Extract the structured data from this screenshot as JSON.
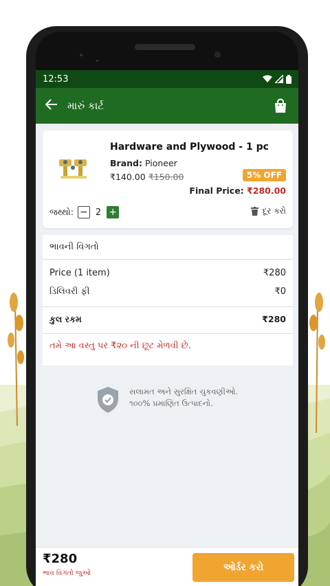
{
  "status": {
    "time": "12:53"
  },
  "appbar": {
    "title": "મારું કાર્ટ",
    "back_icon": "arrow-left-icon",
    "bag_icon": "shopping-bag-icon"
  },
  "product": {
    "name": "Hardware and Plywood - 1 pc",
    "brand_label": "Brand:",
    "brand_value": "Pioneer",
    "price": "₹140.00",
    "old_price": "₹150.00",
    "discount_badge": "5% OFF",
    "final_label": "Final Price:",
    "final_value": "₹280.00",
    "qty_label": "જથ્થો:",
    "qty_value": "2",
    "minus": "−",
    "plus": "+",
    "remove_label": "દૂર કરો"
  },
  "price_details": {
    "heading": "ભાવની વિગતો",
    "rows": [
      {
        "label": "Price (1 item)",
        "value": "₹280"
      },
      {
        "label": "ડિલિવરી ફી",
        "value": "₹0"
      }
    ],
    "total_label": "કુલ રકમ",
    "total_value": "₹280",
    "savings_text": "તમે આ વસ્તુ પર ₹૨૦ ની છૂટ મેળવી છે."
  },
  "secure": {
    "line1": "સલામત અને સુરક્ષિત ચુકવણીઓ.",
    "line2": "૧૦૦% પ્રમાણિત ઉત્પાદનો."
  },
  "bottom": {
    "total": "₹280",
    "link": "ભાવ વિગતો જુઓ",
    "order_button": "ઓર્ડર કરો"
  },
  "colors": {
    "appbar": "#1f6b22",
    "statusbar": "#0f4a14",
    "accent": "#f0a531",
    "danger": "#c62828"
  }
}
